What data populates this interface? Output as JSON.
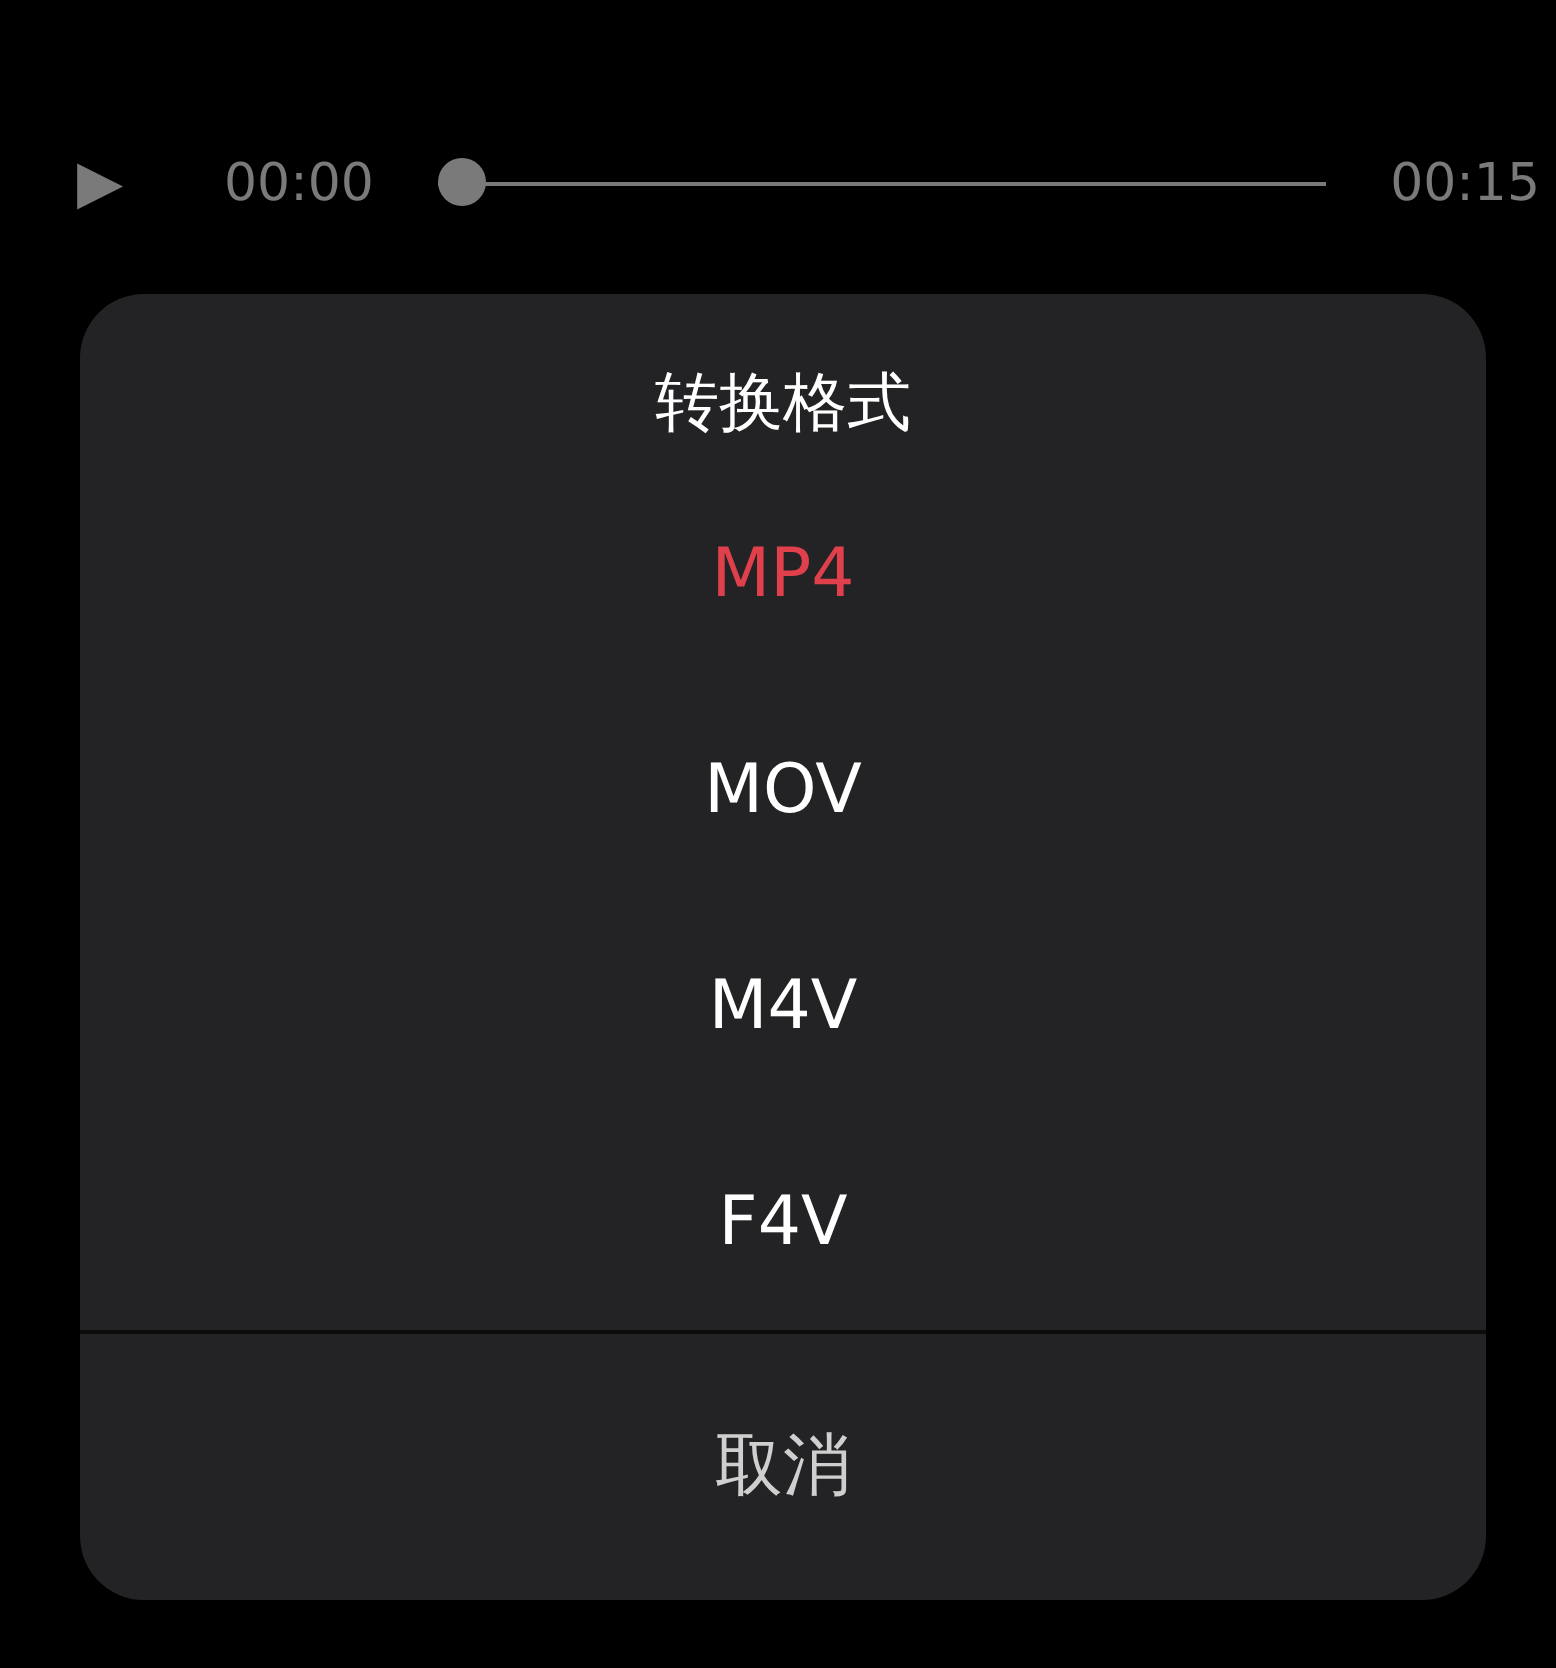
{
  "player": {
    "play_symbol": "▶",
    "elapsed": "00:00",
    "duration": "00:15",
    "level": 0
  },
  "dialog": {
    "title": "转换格式",
    "options": [
      {
        "label": "MP4",
        "selected": true
      },
      {
        "label": "MOV",
        "selected": false
      },
      {
        "label": "M4V",
        "selected": false
      },
      {
        "label": "F4V",
        "selected": false
      }
    ],
    "cancel": "取消"
  }
}
